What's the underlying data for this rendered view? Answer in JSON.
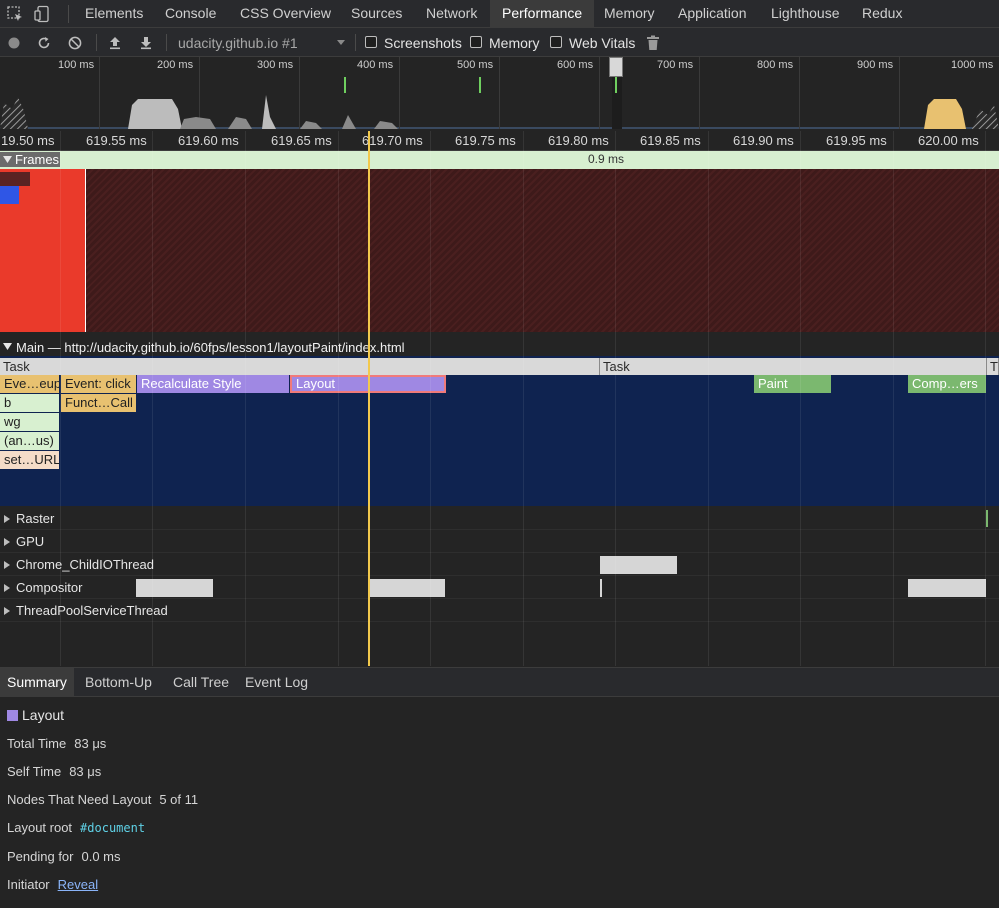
{
  "colors": {
    "panel_bg": "#242424",
    "toolbar_bg": "#292a2d",
    "main_track_bg": "#0f2350",
    "layout_purple": "#9f88e3",
    "event_yellow": "#e8c170",
    "paint_green": "#7bb86f",
    "frame_red": "#ea3a2b",
    "cursor_line": "#f2c94c"
  },
  "tabs": [
    {
      "label": "Elements"
    },
    {
      "label": "Console"
    },
    {
      "label": "CSS Overview"
    },
    {
      "label": "Sources"
    },
    {
      "label": "Network"
    },
    {
      "label": "Performance"
    },
    {
      "label": "Memory"
    },
    {
      "label": "Application"
    },
    {
      "label": "Lighthouse"
    },
    {
      "label": "Redux"
    }
  ],
  "active_tab": "Performance",
  "toolbar": {
    "icons": [
      "record-icon",
      "reload-icon",
      "clear-icon",
      "upload-icon",
      "download-icon",
      "trash-icon"
    ],
    "profile_select": "udacity.github.io #1",
    "checkboxes": [
      {
        "label": "Screenshots",
        "checked": false
      },
      {
        "label": "Memory",
        "checked": false
      },
      {
        "label": "Web Vitals",
        "checked": false
      }
    ]
  },
  "overview": {
    "ticks": [
      "100 ms",
      "200 ms",
      "300 ms",
      "400 ms",
      "500 ms",
      "600 ms",
      "700 ms",
      "800 ms",
      "900 ms",
      "1000 ms"
    ]
  },
  "ruler": {
    "ticks": [
      "19.50 ms",
      "619.55 ms",
      "619.60 ms",
      "619.65 ms",
      "619.70 ms",
      "619.75 ms",
      "619.80 ms",
      "619.85 ms",
      "619.90 ms",
      "619.95 ms",
      "620.00 ms"
    ]
  },
  "frames": {
    "label": "Frames",
    "duration": "0.9 ms"
  },
  "main": {
    "header": "Main — http://udacity.github.io/60fps/lesson1/layoutPaint/index.html",
    "tasks": [
      "Task",
      "Task",
      "T"
    ],
    "events": {
      "event_setup": "Eve…eup",
      "event_click": "Event: click",
      "recalc_style": "Recalculate Style",
      "layout": "Layout",
      "paint": "Paint",
      "composite": "Comp…ers",
      "b": "b",
      "function_call": "Funct…Call",
      "wg": "wg",
      "anon": "(an…us)",
      "set_url": "set…URL"
    }
  },
  "threads": [
    "Raster",
    "GPU",
    "Chrome_ChildIOThread",
    "Compositor",
    "ThreadPoolServiceThread"
  ],
  "bottom_tabs": [
    {
      "label": "Summary"
    },
    {
      "label": "Bottom-Up"
    },
    {
      "label": "Call Tree"
    },
    {
      "label": "Event Log"
    }
  ],
  "active_bottom_tab": "Summary",
  "summary": {
    "title": "Layout",
    "total_time_label": "Total Time",
    "total_time": "83 μs",
    "self_time_label": "Self Time",
    "self_time": "83 μs",
    "nodes_label": "Nodes That Need Layout",
    "nodes_value": "5 of 11",
    "root_label": "Layout root",
    "root_value": "#document",
    "pending_label": "Pending for",
    "pending_value": "0.0 ms",
    "initiator_label": "Initiator",
    "initiator_value": "Reveal"
  }
}
